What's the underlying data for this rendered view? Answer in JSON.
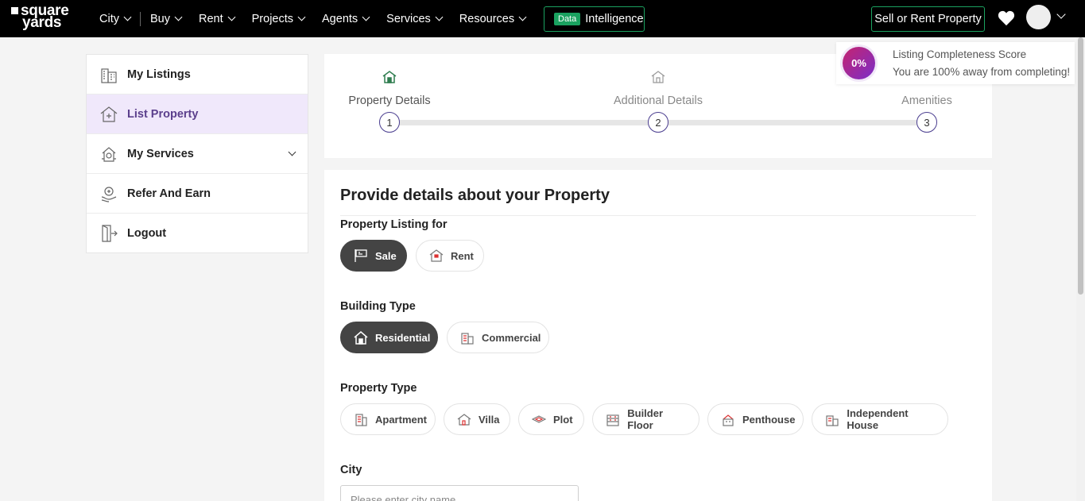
{
  "header": {
    "logo_line1": "square",
    "logo_line2": "yards",
    "nav": [
      "City",
      "Buy",
      "Rent",
      "Projects",
      "Agents",
      "Services",
      "Resources"
    ],
    "data_badge": "Data",
    "intelligence_label": "Intelligence",
    "sell_button": "Sell or Rent Property"
  },
  "sidebar": {
    "items": [
      {
        "label": "My Listings",
        "icon": "building-icon"
      },
      {
        "label": "List Property",
        "icon": "house-plus-icon"
      },
      {
        "label": "My Services",
        "icon": "services-icon"
      },
      {
        "label": "Refer And Earn",
        "icon": "refer-icon"
      },
      {
        "label": "Logout",
        "icon": "logout-icon"
      }
    ]
  },
  "stepper": {
    "steps": [
      {
        "num": "1",
        "title": "Property Details"
      },
      {
        "num": "2",
        "title": "Additional Details"
      },
      {
        "num": "3",
        "title": "Amenities"
      }
    ]
  },
  "completeness": {
    "percent": "0%",
    "title": "Listing Completeness Score",
    "subtitle": "You are 100% away from completing!"
  },
  "form": {
    "title": "Provide details about your Property",
    "listing_for_label": "Property Listing for",
    "listing_options": [
      "Sale",
      "Rent"
    ],
    "building_type_label": "Building Type",
    "building_options": [
      "Residential",
      "Commercial"
    ],
    "property_type_label": "Property Type",
    "property_options": [
      "Apartment",
      "Villa",
      "Plot",
      "Builder Floor",
      "Penthouse",
      "Independent House"
    ],
    "city_label": "City",
    "city_placeholder": "Please enter city name"
  },
  "colors": {
    "accent_green": "#1aa260",
    "active_purple": "#5b3f8c",
    "selected_chip": "#444444"
  }
}
